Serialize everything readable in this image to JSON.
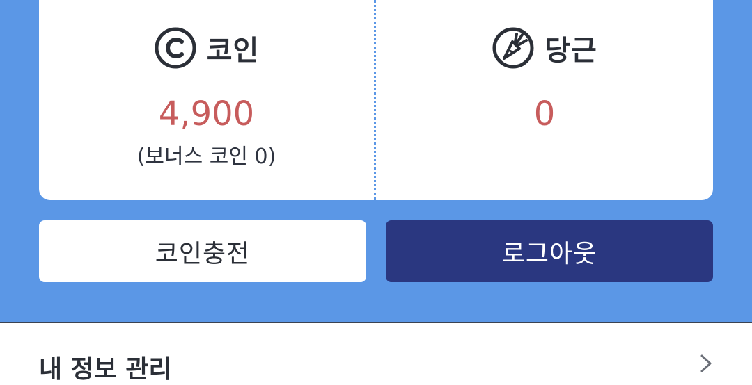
{
  "wallet": {
    "coin": {
      "label": "코인",
      "amount": "4,900",
      "bonus": "(보너스 코인 0)"
    },
    "carrot": {
      "label": "당근",
      "amount": "0"
    }
  },
  "actions": {
    "charge_label": "코인충전",
    "logout_label": "로그아웃"
  },
  "next_section": {
    "label": "내 정보 관리"
  },
  "colors": {
    "panel_blue": "#5b97e6",
    "logout_navy": "#2a3780",
    "amount_red": "#c75c5c"
  },
  "icons": {
    "coin": "copyright-coin-icon",
    "carrot": "carrot-icon",
    "chevron": "chevron-right-icon"
  }
}
